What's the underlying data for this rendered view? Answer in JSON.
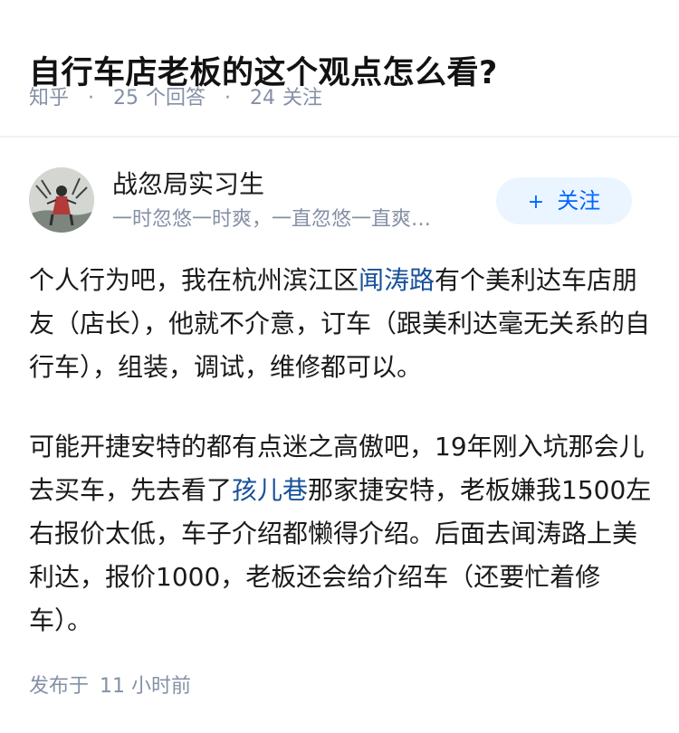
{
  "question": {
    "title": "自行车店老板的这个观点怎么看?",
    "source": "知乎",
    "answer_count": "25",
    "answer_label": "个回答",
    "follower_count": "24",
    "follower_label": "关注",
    "separator": "·"
  },
  "author": {
    "name": "战忽局实习生",
    "bio": "一时忽悠一时爽，一直忽悠一直爽…",
    "follow_plus": "+",
    "follow_label": "关注"
  },
  "answer": {
    "p1_a": "个人行为吧，我在杭州滨江区",
    "p1_link": "闻涛路",
    "p1_b": "有个美利达车店朋友（店长），他就不介意，订车（跟美利达毫无关系的自行车），组装，调试，维修都可以。",
    "p2_a": "可能开捷安特的都有点迷之高傲吧，19年刚入坑那会儿去买车，先去看了",
    "p2_link": "孩儿巷",
    "p2_b": "那家捷安特，老板嫌我1500左右报价太低，车子介绍都懒得介绍。后面去闻涛路上美利达，报价1000，老板还会给介绍车（还要忙着修车）。"
  },
  "footer": {
    "published_label": "发布于",
    "published_time": "11 小时前"
  },
  "colors": {
    "link": "#175199",
    "meta": "#8590a6",
    "follow_bg": "#ebf5ff",
    "follow_text": "#0066ff"
  }
}
